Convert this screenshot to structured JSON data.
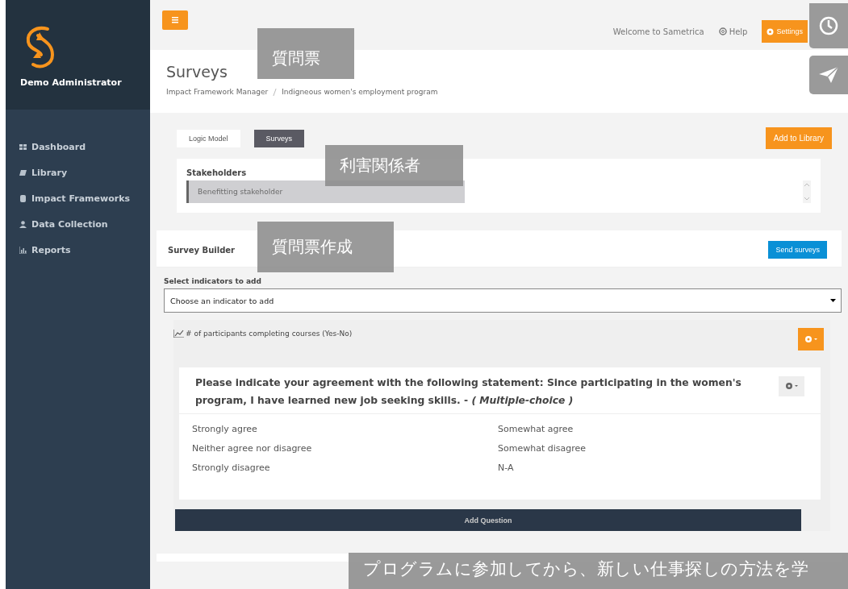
{
  "sidebar": {
    "user_name": "Demo Administrator",
    "items": [
      {
        "label": "Dashboard",
        "selected": false
      },
      {
        "label": "Library",
        "selected": false
      },
      {
        "label": "Impact Frameworks",
        "selected": false
      },
      {
        "label": "Data Collection",
        "selected": false
      },
      {
        "label": "Reports",
        "selected": false
      }
    ]
  },
  "topbar": {
    "welcome": "Welcome to Sametrica",
    "help": "Help",
    "settings": "Settings"
  },
  "header": {
    "title": "Surveys",
    "breadcrumb": [
      "Impact Framework Manager",
      "Indigneous women's employment program"
    ]
  },
  "tabs": [
    {
      "label": "Logic Model",
      "selected": false
    },
    {
      "label": "Surveys",
      "selected": true
    }
  ],
  "add_to_library": "Add to Library",
  "stakeholders": {
    "title": "Stakeholders",
    "value": "Benefitting stakeholder"
  },
  "survey_builder": {
    "title": "Survey Builder",
    "send_button": "Send surveys",
    "select_label": "Select indicators to add",
    "select_value": "Choose an indicator to add",
    "indicator": {
      "title": "# of participants completing courses (Yes-No)",
      "question": {
        "text": "Please indicate your agreement with the following statement: Since participating in the women's program, I have learned new job seeking skills. - *( Multiple-choice )*",
        "options": [
          "Strongly agree",
          "Somewhat agree",
          "Neither agree nor disagree",
          "Somewhat disagree",
          "Strongly disagree",
          "N-A"
        ]
      },
      "add_question": "Add Question"
    }
  },
  "captions": [
    {
      "text": "質問票"
    },
    {
      "text": "利害関係者"
    },
    {
      "text": "質問票作成"
    },
    {
      "text": "プログラムに参加してから、新しい仕事探しの方法を学"
    }
  ]
}
